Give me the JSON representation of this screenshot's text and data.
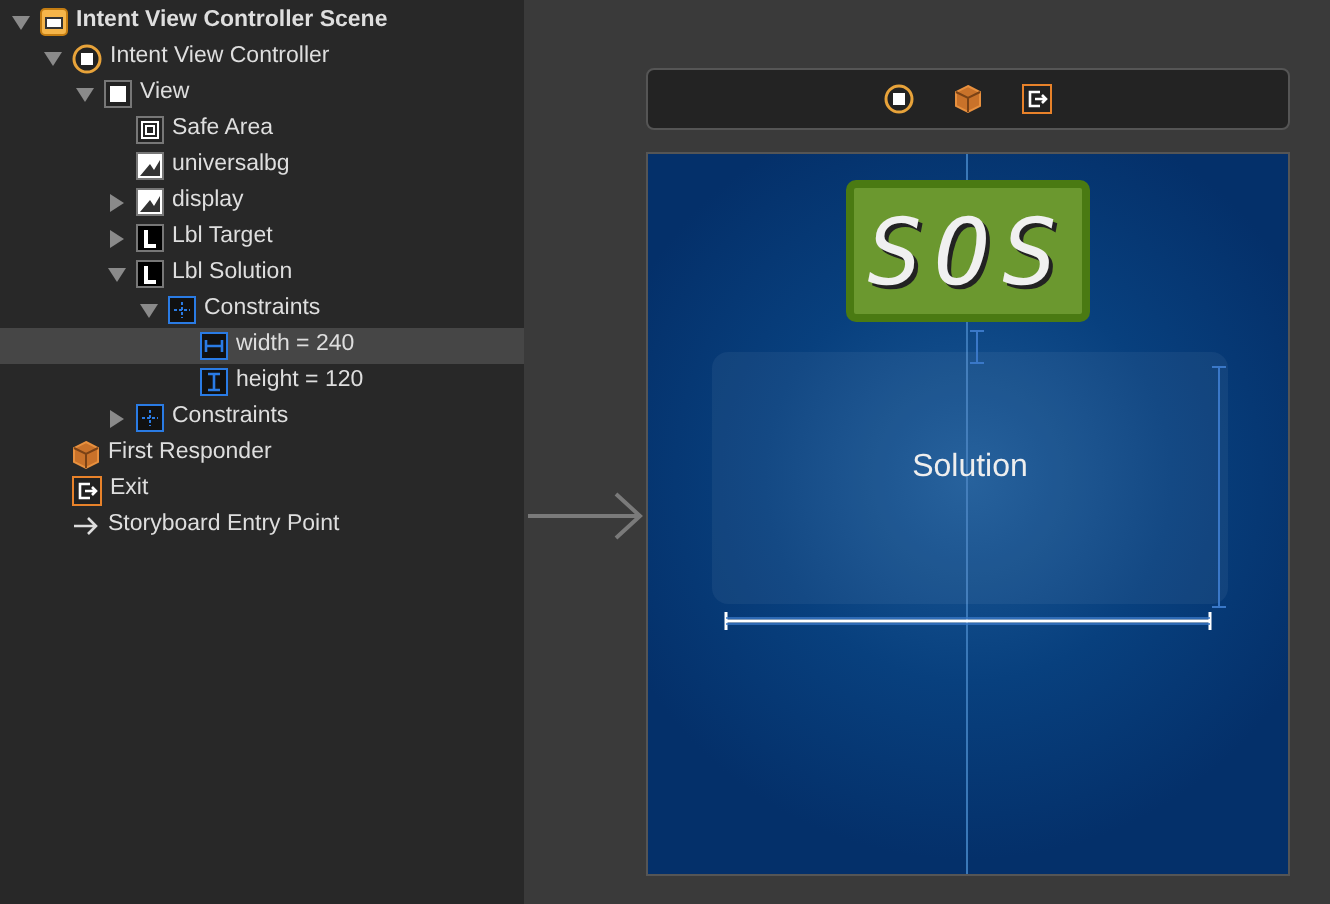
{
  "outline": [
    {
      "label": "Intent View Controller Scene",
      "kind": "scene",
      "expanded": true,
      "selected": false,
      "children": [
        {
          "label": "Intent View Controller",
          "kind": "controller",
          "expanded": true,
          "selected": false,
          "children": [
            {
              "label": "View",
              "kind": "view",
              "expanded": true,
              "selected": false,
              "children": [
                {
                  "label": "Safe Area",
                  "kind": "safearea",
                  "selected": false
                },
                {
                  "label": "universalbg",
                  "kind": "image",
                  "selected": false
                },
                {
                  "label": "display",
                  "kind": "image",
                  "expanded": false,
                  "selected": false
                },
                {
                  "label": "Lbl Target",
                  "kind": "label",
                  "expanded": false,
                  "selected": false
                },
                {
                  "label": "Lbl Solution",
                  "kind": "label",
                  "expanded": true,
                  "selected": false,
                  "children": [
                    {
                      "label": "Constraints",
                      "kind": "constraints",
                      "expanded": true,
                      "selected": false,
                      "children": [
                        {
                          "label": "width = 240",
                          "kind": "width",
                          "selected": true
                        },
                        {
                          "label": "height = 120",
                          "kind": "height",
                          "selected": false
                        }
                      ]
                    }
                  ]
                },
                {
                  "label": "Constraints",
                  "kind": "constraints",
                  "expanded": false,
                  "selected": false
                }
              ]
            }
          ]
        },
        {
          "label": "First Responder",
          "kind": "responder",
          "selected": false
        },
        {
          "label": "Exit",
          "kind": "exit",
          "selected": false
        },
        {
          "label": "Storyboard Entry Point",
          "kind": "entry",
          "selected": false
        }
      ]
    }
  ],
  "canvas": {
    "display_text": "SOS",
    "label_text": "Solution"
  }
}
